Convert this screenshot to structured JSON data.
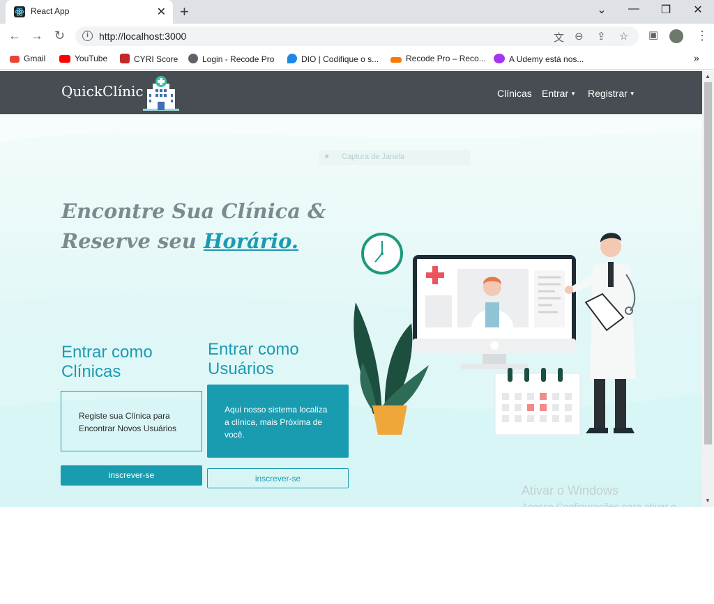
{
  "browser": {
    "tab_title": "React App",
    "url": "http://localhost:3000",
    "bookmarks": [
      {
        "label": "Gmail",
        "color": "#ea4335"
      },
      {
        "label": "YouTube",
        "color": "#ff0000"
      },
      {
        "label": "CYRI Score",
        "color": "#c62828"
      },
      {
        "label": "Login - Recode Pro",
        "color": "#5f6368"
      },
      {
        "label": "DIO | Codifique o s...",
        "color": "#1e88e5"
      },
      {
        "label": "Recode Pro – Reco...",
        "color": "#f57c00"
      },
      {
        "label": "A Udemy está nos...",
        "color": "#a435f0"
      }
    ],
    "more_bookmarks": "»"
  },
  "navbar": {
    "brand": "QuickClínic",
    "links": {
      "clinicas": "Clínicas",
      "entrar": "Entrar",
      "registrar": "Registrar"
    }
  },
  "overlay": {
    "capture_label": "Captura de Janela"
  },
  "hero": {
    "headline_line1": "Encontre Sua Clínica &",
    "headline_line2_prefix": "Reserve seu",
    "headline_highlight": "Horário."
  },
  "clinicas": {
    "title_line1": "Entrar como",
    "title_line2": "Clínicas",
    "card_text": "Registe sua Clínica para Encontrar Novos Usuários",
    "button": "inscrever-se"
  },
  "usuarios": {
    "title_line1": "Entrar como",
    "title_line2": "Usuários",
    "card_text": "Aqui nosso sistema localiza a clínica, mais Próxima de você.",
    "button": "inscrever-se"
  },
  "watermark": {
    "title": "Ativar o Windows",
    "subtitle": "Acesse Configurações para ativar o Windows."
  },
  "colors": {
    "accent": "#1a9cb0",
    "navbar": "#474d52",
    "hero_bg": "#e3f7f7"
  }
}
